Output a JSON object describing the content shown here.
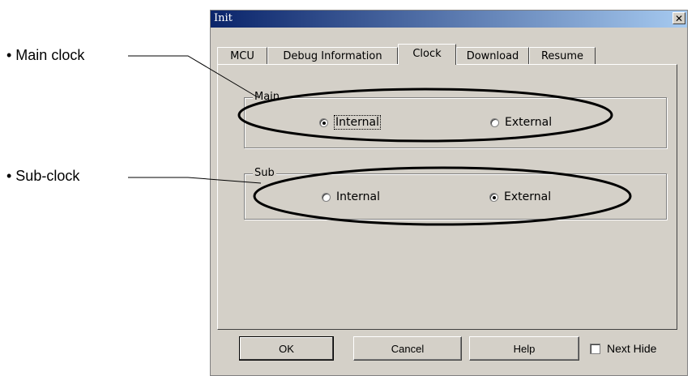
{
  "callouts": {
    "main_clock": "• Main clock",
    "sub_clock": "• Sub-clock"
  },
  "dialog": {
    "title": "Init",
    "close_glyph": "✕"
  },
  "tabs": [
    {
      "label": "MCU",
      "active": false
    },
    {
      "label": "Debug Information",
      "active": false
    },
    {
      "label": "Clock",
      "active": true
    },
    {
      "label": "Download",
      "active": false
    },
    {
      "label": "Resume",
      "active": false
    }
  ],
  "groups": {
    "main": {
      "label": "Main",
      "options": [
        {
          "label": "Internal",
          "checked": true
        },
        {
          "label": "External",
          "checked": false
        }
      ]
    },
    "sub": {
      "label": "Sub",
      "options": [
        {
          "label": "Internal",
          "checked": false
        },
        {
          "label": "External",
          "checked": true
        }
      ]
    }
  },
  "buttons": {
    "ok": "OK",
    "cancel": "Cancel",
    "help": "Help"
  },
  "next_hide": {
    "label": "Next Hide",
    "checked": false
  }
}
